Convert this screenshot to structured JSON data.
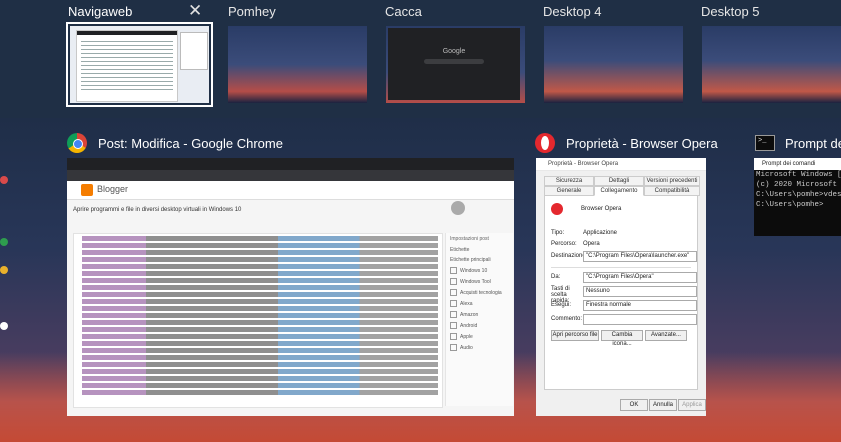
{
  "desktops": [
    {
      "label": "Navigaweb",
      "active": true
    },
    {
      "label": "Pomhey",
      "active": false
    },
    {
      "label": "Cacca",
      "active": false
    },
    {
      "label": "Desktop 4",
      "active": false
    },
    {
      "label": "Desktop 5",
      "active": false
    }
  ],
  "cacca_thumb_search": "Google",
  "windows": {
    "chrome": {
      "title": "Post: Modifica - Google Chrome",
      "app_name": "Blogger",
      "post_title": "Aprire programmi e file in diversi desktop virtuali in Windows 10",
      "sidebar_title": "Impostazioni post",
      "sidebar_sections": [
        "Etichette",
        "Etichette principali"
      ],
      "labels": [
        "Windows 10",
        "Windows Tool",
        "Acquisti tecnologia",
        "Alexa",
        "Amazon",
        "Android",
        "Apple",
        "Audio"
      ]
    },
    "opera_props": {
      "title": "Proprietà - Browser Opera",
      "dialog_title": "Proprietà - Browser Opera",
      "tabs_row1": [
        "Sicurezza",
        "Dettagli",
        "Versioni precedenti"
      ],
      "tabs_row2": [
        "Generale",
        "Collegamento",
        "Compatibilità"
      ],
      "app_name": "Browser Opera",
      "rows": [
        {
          "label": "Tipo:",
          "value": "Applicazione"
        },
        {
          "label": "Percorso:",
          "value": "Opera"
        },
        {
          "label": "Destinazione:",
          "value": "\"C:\\Program Files\\Opera\\launcher.exe\""
        },
        {
          "label": "Da:",
          "value": "\"C:\\Program Files\\Opera\""
        },
        {
          "label": "Tasti di scelta rapida:",
          "value": "Nessuno"
        },
        {
          "label": "Esegui:",
          "value": "Finestra normale"
        },
        {
          "label": "Commento:",
          "value": ""
        }
      ],
      "buttons": [
        "Apri percorso file",
        "Cambia icona...",
        "Avanzate..."
      ],
      "footer": [
        "OK",
        "Annulla",
        "Applica"
      ]
    },
    "cmd": {
      "title": "Prompt dei comandi",
      "title_short": "Prompt de",
      "lines": [
        "Microsoft Windows [Ve",
        "(c) 2020 Microsoft Co",
        "",
        "C:\\Users\\pomhe>vdesk",
        "",
        "C:\\Users\\pomhe>"
      ]
    }
  }
}
